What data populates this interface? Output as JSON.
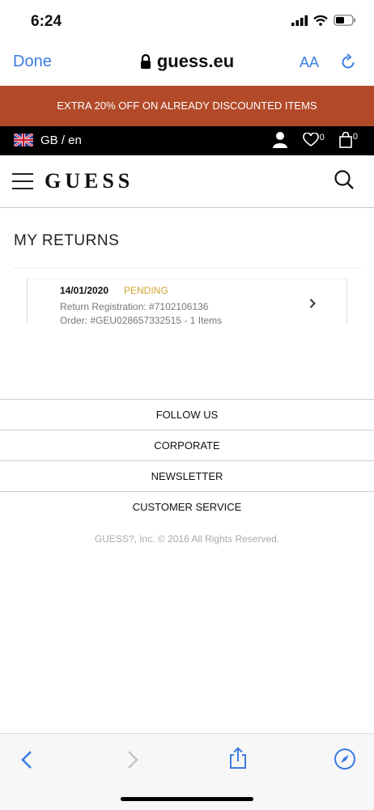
{
  "status_bar": {
    "time": "6:24"
  },
  "safari": {
    "done_label": "Done",
    "url": "guess.eu",
    "text_size_label": "AA"
  },
  "promo": {
    "text": "EXTRA 20% OFF ON ALREADY DISCOUNTED ITEMS",
    "color": "#b24a29"
  },
  "locale": {
    "text": "GB / en"
  },
  "header_counts": {
    "wishlist": "0",
    "bag": "0"
  },
  "brand": {
    "logo": "GUESS"
  },
  "page": {
    "title": "MY RETURNS"
  },
  "returns": [
    {
      "date": "14/01/2020",
      "status": "PENDING",
      "registration": "Return Registration: #7102106136",
      "order": "Order: #GEU028657332515 - 1 Items"
    }
  ],
  "footer": {
    "links": [
      "FOLLOW US",
      "CORPORATE",
      "NEWSLETTER",
      "CUSTOMER SERVICE"
    ],
    "copyright": "GUESS?, Inc. © 2016 All Rights Reserved."
  },
  "colors": {
    "accent_blue": "#3b7de0",
    "pending": "#cda42c"
  },
  "icons": [
    "signal-icon",
    "wifi-icon",
    "battery-icon",
    "lock-icon",
    "reload-icon",
    "uk-flag-icon",
    "user-icon",
    "heart-icon",
    "bag-icon",
    "search-icon",
    "chevron-right-icon",
    "back-icon",
    "forward-icon",
    "share-icon",
    "compass-icon"
  ]
}
